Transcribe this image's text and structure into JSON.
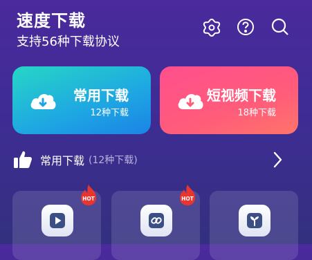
{
  "header": {
    "title": "速度下载",
    "subtitle": "支持56种下载协议",
    "icons": [
      "settings-flower-icon",
      "help-icon",
      "search-icon"
    ]
  },
  "cards": [
    {
      "title": "常用下载",
      "sub": "12种下载",
      "icon": "cloud-download-icon",
      "color": "#1ea6e3"
    },
    {
      "title": "短视频下载",
      "sub": "18种下载",
      "icon": "cloud-download-icon",
      "color": "#ff5c7a"
    }
  ],
  "section": {
    "icon": "thumbs-up-icon",
    "title": "常用下载",
    "count": "(12种下载)"
  },
  "tiles": [
    {
      "icon": "play-icon",
      "badge": "HOT"
    },
    {
      "icon": "link-icon",
      "badge": "HOT"
    },
    {
      "icon": "sprout-icon",
      "badge": ""
    }
  ]
}
